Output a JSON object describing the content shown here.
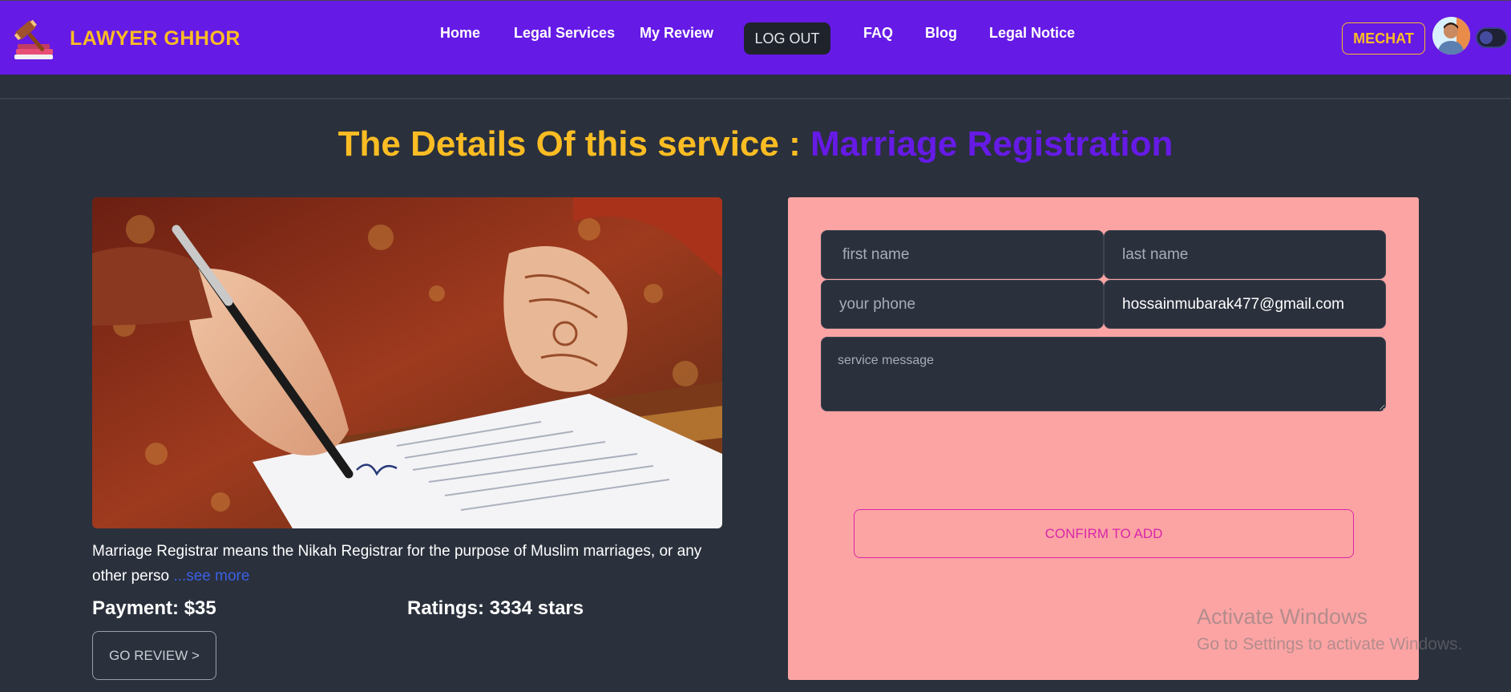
{
  "brand": {
    "name": "LAWYER GHHOR",
    "logo_icon": "gavel-books-icon"
  },
  "nav": {
    "links": [
      "Home",
      "Legal Services",
      "My Review",
      "FAQ",
      "Blog",
      "Legal Notice"
    ],
    "logout_label": "LOG OUT",
    "mechat_label": "MECHAT",
    "avatar_icon": "user-avatar-icon",
    "theme_toggle_icon": "theme-toggle-icon"
  },
  "heading": {
    "prefix": "The Details Of this service : ",
    "service": "Marriage Registration"
  },
  "service": {
    "image_icon": "marriage-signing-photo",
    "description": "Marriage Registrar means the Nikah Registrar for the purpose of Muslim marriages, or any other perso ",
    "see_more": "...see more",
    "payment": "Payment: $35",
    "ratings": "Ratings: 3334 stars",
    "go_review_label": "GO REVIEW >"
  },
  "form": {
    "first_name_placeholder": "first name",
    "last_name_placeholder": "last name",
    "phone_placeholder": "your phone",
    "email_value": "hossainmubarak477@gmail.com",
    "message_placeholder": "service message",
    "confirm_label": "CONFIRM TO ADD"
  },
  "watermark": {
    "line1": "Activate Windows",
    "line2": "Go to Settings to activate Windows."
  },
  "colors": {
    "nav_bg": "#661ae6",
    "accent_yellow": "#fbbd23",
    "page_bg": "#2a303c",
    "form_bg": "#fca4a4",
    "confirm_pink": "#d926a9"
  }
}
